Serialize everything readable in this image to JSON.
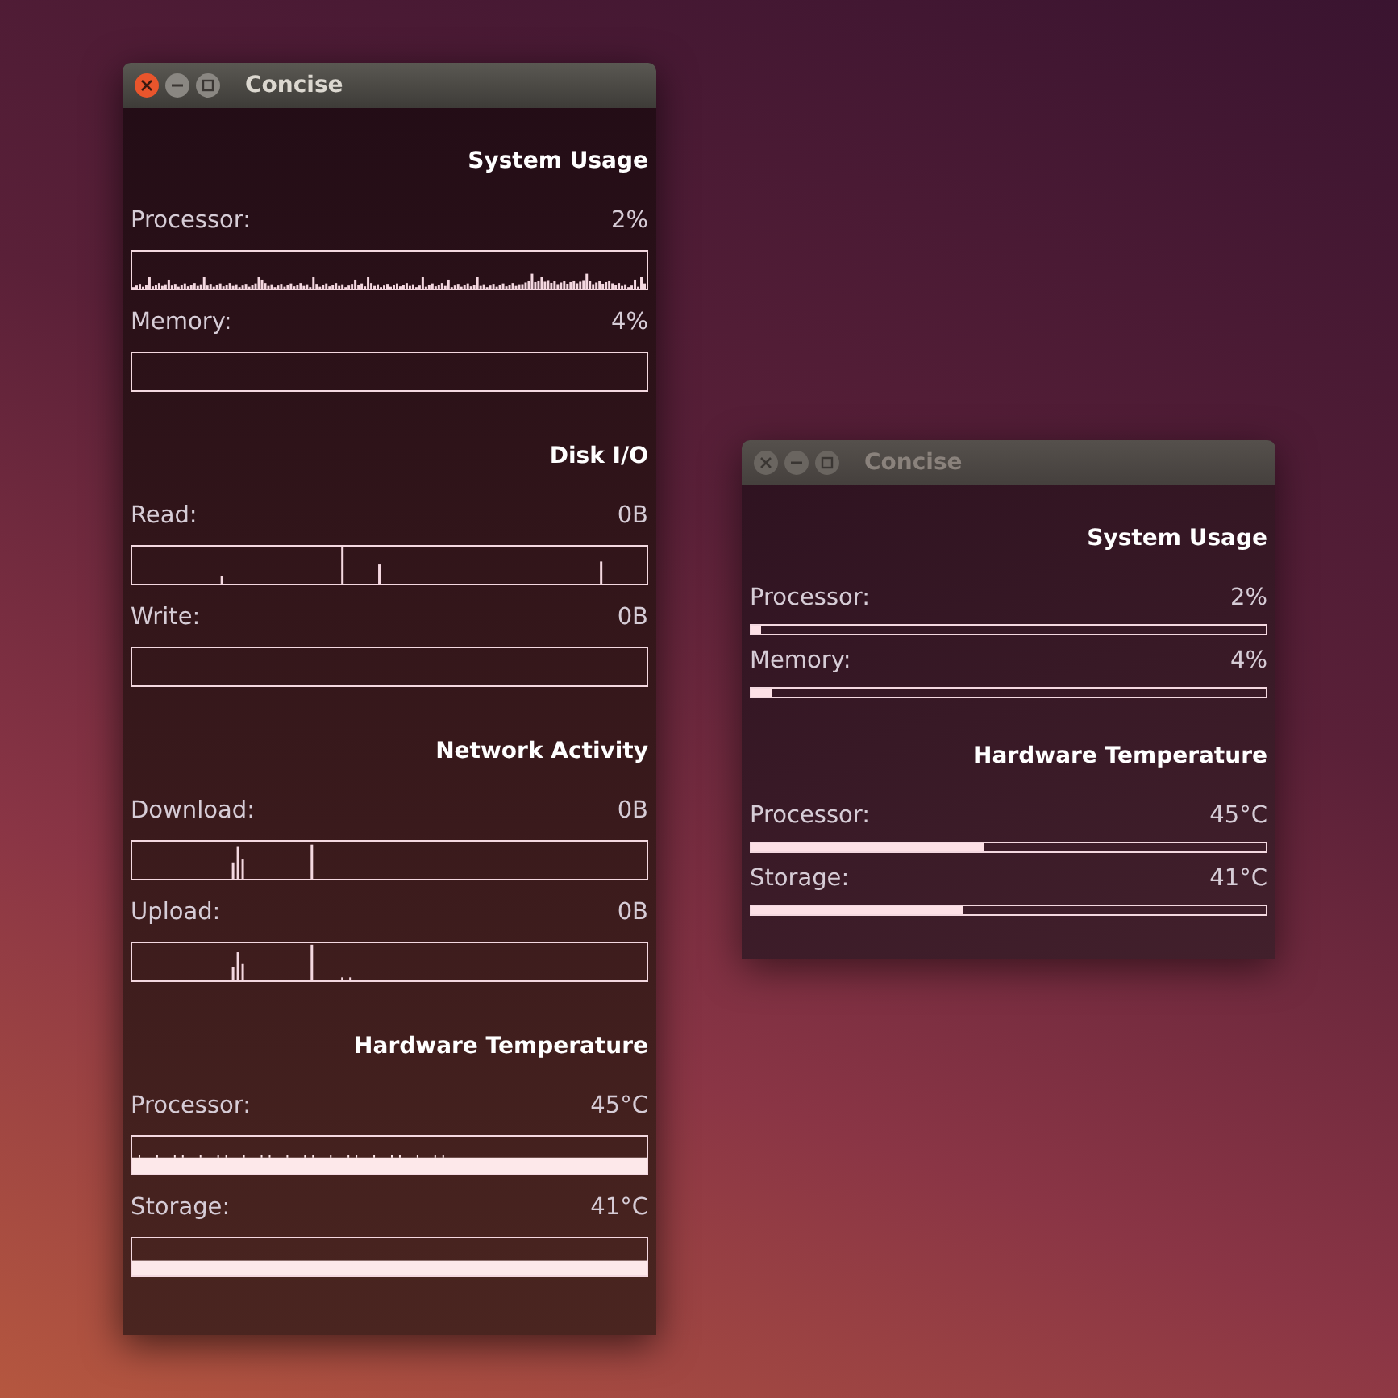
{
  "windows": [
    {
      "title": "Concise",
      "focused": true,
      "sections": [
        {
          "heading": "System Usage",
          "metrics": [
            {
              "label": "Processor:",
              "reading": "2%",
              "kind": "graph"
            },
            {
              "label": "Memory:",
              "reading": "4%",
              "kind": "graph"
            }
          ]
        },
        {
          "heading": "Disk I/O",
          "metrics": [
            {
              "label": "Read:",
              "reading": "0B",
              "kind": "graph"
            },
            {
              "label": "Write:",
              "reading": "0B",
              "kind": "graph"
            }
          ]
        },
        {
          "heading": "Network Activity",
          "metrics": [
            {
              "label": "Download:",
              "reading": "0B",
              "kind": "graph"
            },
            {
              "label": "Upload:",
              "reading": "0B",
              "kind": "graph"
            }
          ]
        },
        {
          "heading": "Hardware Temperature",
          "metrics": [
            {
              "label": "Processor:",
              "reading": "45°C",
              "kind": "graph"
            },
            {
              "label": "Storage:",
              "reading": "41°C",
              "kind": "graph"
            }
          ]
        }
      ]
    },
    {
      "title": "Concise",
      "focused": false,
      "sections": [
        {
          "heading": "System Usage",
          "metrics": [
            {
              "label": "Processor:",
              "reading": "2%",
              "kind": "bar",
              "level": 0.02
            },
            {
              "label": "Memory:",
              "reading": "4%",
              "kind": "bar",
              "level": 0.04
            }
          ]
        },
        {
          "heading": "Hardware Temperature",
          "metrics": [
            {
              "label": "Processor:",
              "reading": "45°C",
              "kind": "bar",
              "level": 0.45
            },
            {
              "label": "Storage:",
              "reading": "41°C",
              "kind": "bar",
              "level": 0.41
            }
          ]
        }
      ]
    }
  ]
}
